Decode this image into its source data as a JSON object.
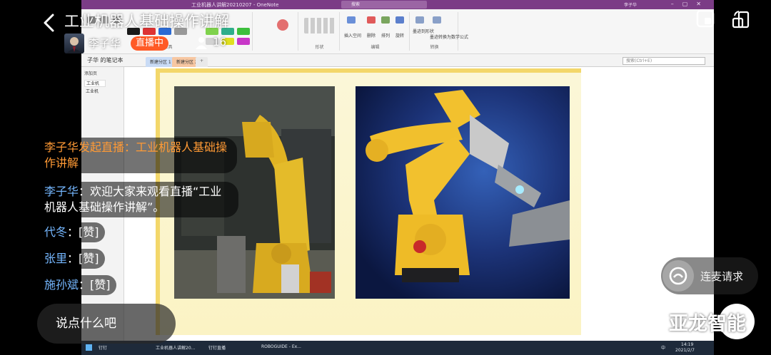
{
  "live": {
    "title": "工业机器人基础操作讲解",
    "host_name": "李子华",
    "status_badge": "直播中",
    "viewer_count": "16",
    "comment_placeholder": "说点什么吧",
    "connect_button": "连麦请求"
  },
  "chat": [
    {
      "type": "system",
      "text": "李子华发起直播：工业机器人基础操作讲解"
    },
    {
      "type": "message",
      "name": "李子华",
      "text": "：欢迎大家来观看直播“工业机器人基础操作讲解”。"
    },
    {
      "type": "message",
      "name": "代冬",
      "text": "：[赞]"
    },
    {
      "type": "message",
      "name": "张里",
      "text": "：[赞]"
    },
    {
      "type": "message",
      "name": "施孙斌",
      "text": "：[赞]"
    }
  ],
  "watermark": "亚龙智能",
  "onenote": {
    "window_title": "工业机器人讲解20210207 - OneNote",
    "search_label": "搜索",
    "user_label": "李子华",
    "notebook_name": "子华 的笔记本",
    "tabs": [
      "新建分区 1",
      "新建分区 2",
      "+"
    ],
    "search_placeholder": "搜索(Ctrl+E)",
    "add_page": "添加页",
    "pages": [
      "工业机",
      "工业机"
    ],
    "ribbon_groups": [
      {
        "label": "工具"
      },
      {
        "label": "形状"
      },
      {
        "label": "编辑"
      },
      {
        "label": "转换"
      }
    ],
    "ribbon_items": [
      "插入空间",
      "删除",
      "排列",
      "旋转",
      "墨迹到形状",
      "墨迹转换为数学公式"
    ]
  },
  "taskbar": {
    "items": [
      "钉钉",
      "工业机器人讲解20...",
      "钉钉直播",
      "ROBOGUIDE - Ex..."
    ],
    "time": "14:19",
    "date": "2021/2/7",
    "ime": "中"
  },
  "colors": {
    "live_badge": "#ff5a26",
    "chat_name": "#75b7ff",
    "system_message": "#ff9a35",
    "onenote_purple": "#7b3c86",
    "robot_yellow": "#f2c12e"
  }
}
